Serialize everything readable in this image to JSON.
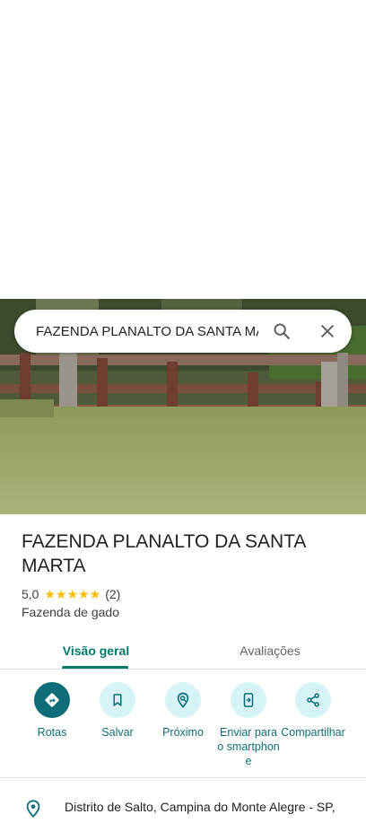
{
  "search": {
    "query": "FAZENDA PLANALTO DA SANTA MA"
  },
  "place": {
    "title": "FAZENDA PLANALTO DA SANTA MARTA",
    "rating": "5,0",
    "stars": "★★★★★",
    "review_count": "(2)",
    "category": "Fazenda de gado",
    "address": "Distrito de Salto, Campina do Monte Alegre - SP,"
  },
  "tabs": [
    {
      "label": "Visão geral",
      "active": true
    },
    {
      "label": "Avaliações",
      "active": false
    }
  ],
  "actions": [
    {
      "label": "Rotas",
      "icon": "directions-icon"
    },
    {
      "label": "Salvar",
      "icon": "bookmark-icon"
    },
    {
      "label": "Próximo",
      "icon": "nearby-icon"
    },
    {
      "label": "Enviar para o smartphone",
      "icon": "send-to-phone-icon"
    },
    {
      "label": "Compartilhar",
      "icon": "share-icon"
    }
  ],
  "colors": {
    "accent": "#0e6d79",
    "tab_active": "#00796b",
    "action_bg": "#d6f3f5",
    "star": "#fbbc04"
  }
}
